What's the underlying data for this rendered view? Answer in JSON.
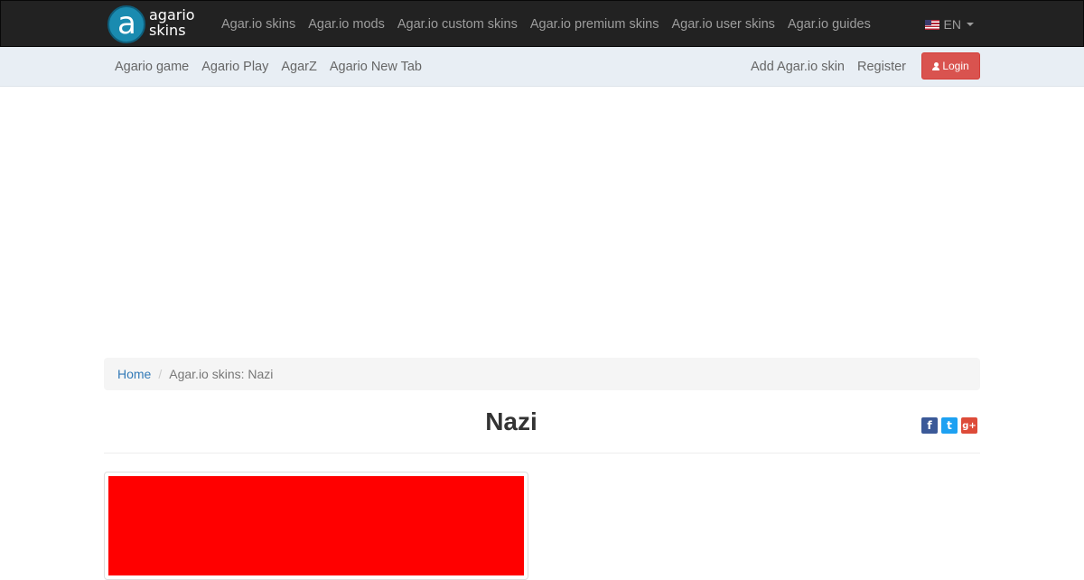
{
  "brand": {
    "line1": "agario",
    "line2": "skins",
    "letter": "a"
  },
  "topnav": [
    "Agar.io skins",
    "Agar.io mods",
    "Agar.io custom skins",
    "Agar.io premium skins",
    "Agar.io user skins",
    "Agar.io guides"
  ],
  "language": {
    "label": "EN",
    "flag": "us-flag-icon"
  },
  "subnav": {
    "left": [
      "Agario game",
      "Agario Play",
      "AgarZ",
      "Agario New Tab"
    ],
    "add_skin": "Add Agar.io skin",
    "register": "Register",
    "login": "Login"
  },
  "breadcrumb": {
    "home": "Home",
    "separator": "/",
    "current": "Agar.io skins: Nazi"
  },
  "title": "Nazi",
  "share": {
    "facebook": "f",
    "twitter": "t",
    "googleplus": "g+"
  },
  "colors": {
    "skin": "#ff0000",
    "login_button": "#d9534f",
    "topbar": "#222222",
    "link": "#337ab7"
  }
}
